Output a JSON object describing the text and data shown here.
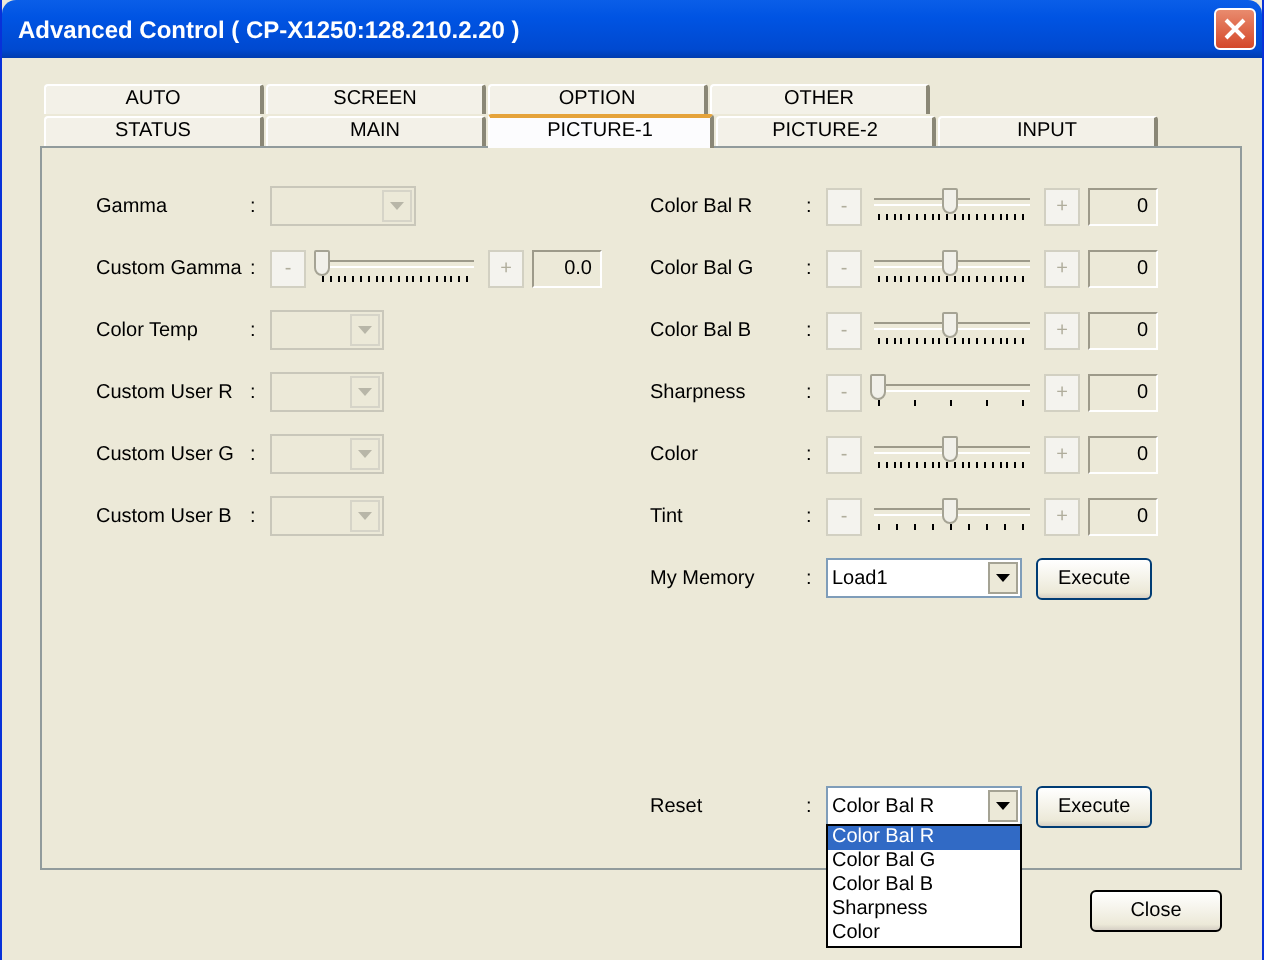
{
  "window": {
    "title": "Advanced Control ( CP-X1250:128.210.2.20 )"
  },
  "tabs": [
    [
      {
        "label": "AUTO",
        "selected": false
      },
      {
        "label": "SCREEN",
        "selected": false
      },
      {
        "label": "OPTION",
        "selected": false
      },
      {
        "label": "OTHER",
        "selected": false
      }
    ],
    [
      {
        "label": "STATUS",
        "selected": false
      },
      {
        "label": "MAIN",
        "selected": false
      },
      {
        "label": "PICTURE-1",
        "selected": true
      },
      {
        "label": "PICTURE-2",
        "selected": false
      },
      {
        "label": "INPUT",
        "selected": false
      }
    ]
  ],
  "left_rows": [
    {
      "kind": "wide-combo",
      "label": "Gamma",
      "separator": ":",
      "disabled": true
    },
    {
      "kind": "fine-slider",
      "label": "Custom Gamma",
      "separator": ":",
      "disabled": true,
      "level": 0,
      "minus": "-",
      "plus": "+",
      "value": "0.0"
    },
    {
      "kind": "combo",
      "label": "Color Temp",
      "separator": ":",
      "disabled": true
    },
    {
      "kind": "combo",
      "label": "Custom User R",
      "separator": ":",
      "disabled": true
    },
    {
      "kind": "combo",
      "label": "Custom User G",
      "separator": ":",
      "disabled": true
    },
    {
      "kind": "combo",
      "label": "Custom User B",
      "separator": ":",
      "disabled": true
    }
  ],
  "right_rows": [
    {
      "kind": "fine-slider",
      "label": "Color Bal R",
      "separator": ":",
      "disabled": true,
      "level": 0.5,
      "minus": "-",
      "plus": "+",
      "value": "0"
    },
    {
      "kind": "fine-slider",
      "label": "Color Bal G",
      "separator": ":",
      "disabled": true,
      "level": 0.5,
      "minus": "-",
      "plus": "+",
      "value": "0"
    },
    {
      "kind": "fine-slider",
      "label": "Color Bal B",
      "separator": ":",
      "disabled": true,
      "level": 0.5,
      "minus": "-",
      "plus": "+",
      "value": "0"
    },
    {
      "kind": "coarse-slider",
      "label": "Sharpness",
      "separator": ":",
      "disabled": true,
      "level": 0,
      "minus": "-",
      "plus": "+",
      "value": "0"
    },
    {
      "kind": "fine-slider",
      "label": "Color",
      "separator": ":",
      "disabled": true,
      "level": 0.5,
      "minus": "-",
      "plus": "+",
      "value": "0"
    },
    {
      "kind": "medium-slider",
      "label": "Tint",
      "separator": ":",
      "disabled": true,
      "level": 0.5,
      "minus": "-",
      "plus": "+",
      "value": "0"
    },
    {
      "kind": "action",
      "label": "My Memory",
      "separator": ":",
      "disabled": false,
      "value": "Load1",
      "button": "Execute"
    }
  ],
  "reset": {
    "label": "Reset",
    "separator": ":",
    "value": "Color Bal R",
    "button": "Execute",
    "expanded": true,
    "options": [
      {
        "label": "Color Bal R",
        "selected": true
      },
      {
        "label": "Color Bal G",
        "selected": false
      },
      {
        "label": "Color Bal B",
        "selected": false
      },
      {
        "label": "Sharpness",
        "selected": false
      },
      {
        "label": "Color",
        "selected": false
      }
    ]
  },
  "close_button": "Close"
}
